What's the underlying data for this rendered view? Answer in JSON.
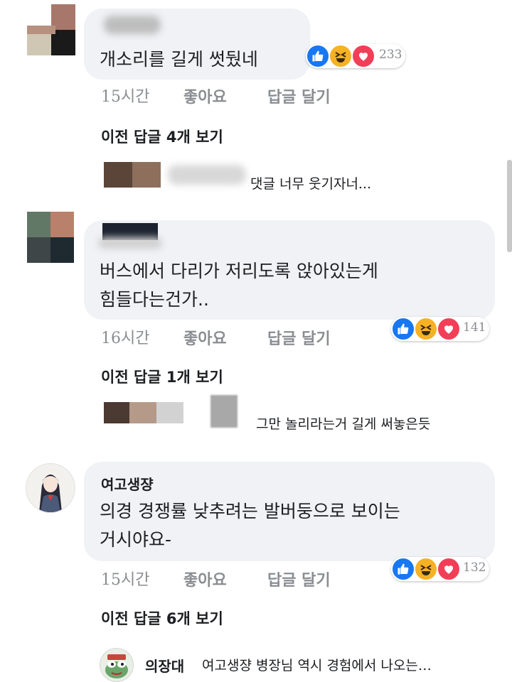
{
  "comments": [
    {
      "author": "",
      "text": "개소리를 길게 썻뒀네",
      "time": "15시간",
      "like_label": "좋아요",
      "reply_label": "답글 달기",
      "reaction_count": "233",
      "view_replies": "이전 답글 4개 보기",
      "reply_preview": "댓글 너무 웃기자너..."
    },
    {
      "author": "",
      "text": "버스에서 다리가 저리도록 앉아있는게\n힘들다는건가..",
      "time": "16시간",
      "like_label": "좋아요",
      "reply_label": "답글 달기",
      "reaction_count": "141",
      "view_replies": "이전 답글 1개 보기",
      "reply_preview": "그만 놀리라는거 길게 써놓은듯"
    },
    {
      "author": "여고생쟝",
      "text": "의경 경쟁률 낮추려는 발버둥으로 보이는\n거시야요-",
      "time": "15시간",
      "like_label": "좋아요",
      "reply_label": "답글 달기",
      "reaction_count": "132",
      "view_replies": "이전 답글 6개 보기",
      "reply_author": "의장대",
      "reply_preview": "여고생쟝 병장님 역시 경험에서 나오는…"
    }
  ],
  "reaction_icons": [
    "like-icon",
    "haha-icon",
    "love-icon"
  ],
  "colors": {
    "like": "#1877f2",
    "haha": "#f7b125",
    "love": "#f33e58",
    "bubble": "#f0f2f5",
    "meta": "#8a8d91"
  }
}
